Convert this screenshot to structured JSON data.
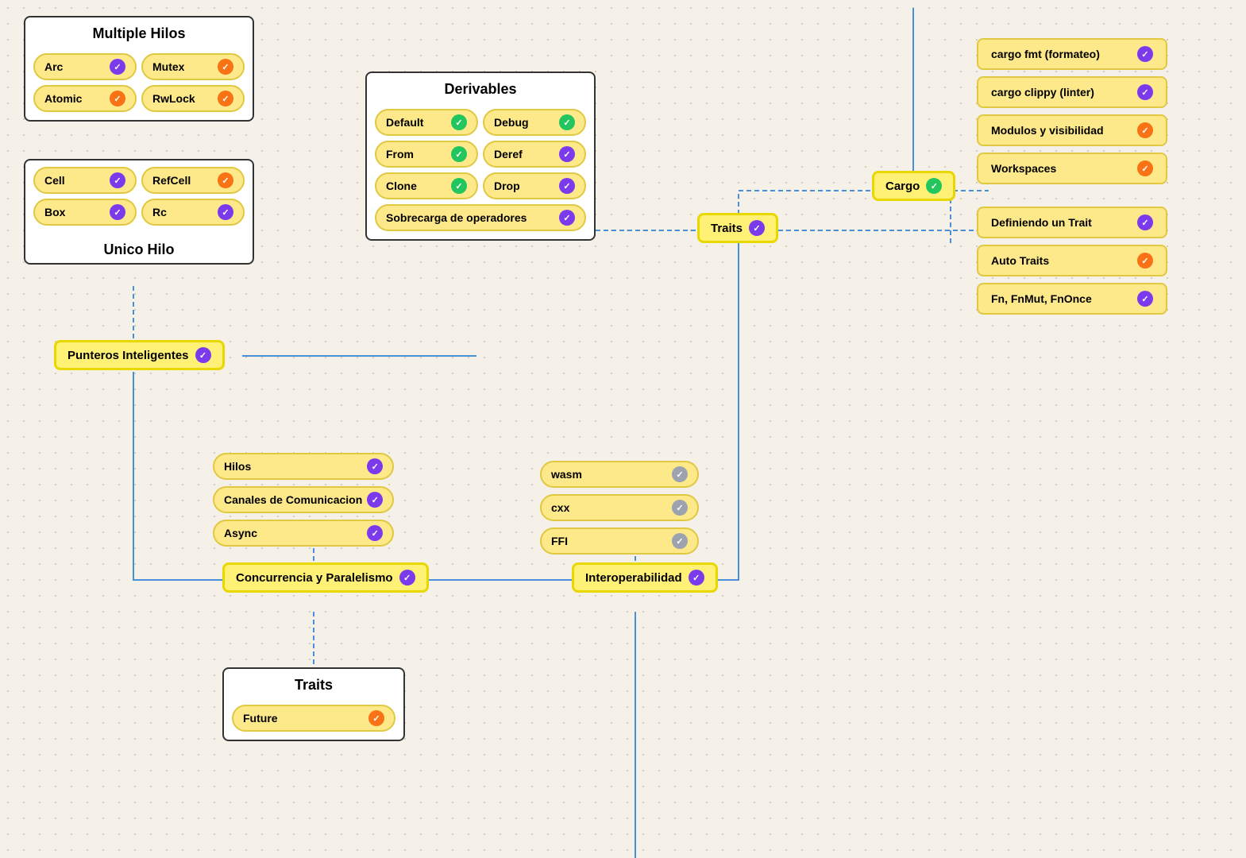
{
  "multipleHilos": {
    "title": "Multiple Hilos",
    "items": [
      {
        "label": "Arc",
        "check": "purple"
      },
      {
        "label": "Mutex",
        "check": "orange"
      },
      {
        "label": "Atomic",
        "check": "orange"
      },
      {
        "label": "RwLock",
        "check": "orange"
      }
    ]
  },
  "unicoHilo": {
    "title": "Unico Hilo",
    "items": [
      {
        "label": "Cell",
        "check": "purple"
      },
      {
        "label": "RefCell",
        "check": "orange"
      },
      {
        "label": "Box",
        "check": "purple"
      },
      {
        "label": "Rc",
        "check": "purple"
      }
    ]
  },
  "punterosInteligentes": {
    "label": "Punteros Inteligentes",
    "check": "purple"
  },
  "derivables": {
    "title": "Derivables",
    "items": [
      {
        "label": "Default",
        "check": "green"
      },
      {
        "label": "Debug",
        "check": "green"
      },
      {
        "label": "From",
        "check": "green"
      },
      {
        "label": "Deref",
        "check": "purple"
      },
      {
        "label": "Clone",
        "check": "green"
      },
      {
        "label": "Drop",
        "check": "purple"
      },
      {
        "label": "Sobrecarga de operadores",
        "check": "purple",
        "wide": true
      }
    ]
  },
  "traits": {
    "label": "Traits",
    "check": "purple"
  },
  "cargo": {
    "label": "Cargo",
    "check": "green"
  },
  "cargoItems": [
    {
      "label": "cargo fmt (formateo)",
      "check": "purple"
    },
    {
      "label": "cargo clippy (linter)",
      "check": "purple"
    },
    {
      "label": "Modulos y visibilidad",
      "check": "orange"
    },
    {
      "label": "Workspaces",
      "check": "orange"
    }
  ],
  "traitsItems": [
    {
      "label": "Definiendo un Trait",
      "check": "purple"
    },
    {
      "label": "Auto Traits",
      "check": "orange"
    },
    {
      "label": "Fn, FnMut, FnOnce",
      "check": "purple"
    }
  ],
  "concurrencia": {
    "label": "Concurrencia y Paralelismo",
    "check": "purple"
  },
  "concurrenciaItems": [
    {
      "label": "Hilos",
      "check": "purple"
    },
    {
      "label": "Canales de Comunicacion",
      "check": "purple"
    },
    {
      "label": "Async",
      "check": "purple"
    }
  ],
  "interoperabilidad": {
    "label": "Interoperabilidad",
    "check": "purple"
  },
  "interopItems": [
    {
      "label": "wasm",
      "check": "gray"
    },
    {
      "label": "cxx",
      "check": "gray"
    },
    {
      "label": "FFI",
      "check": "gray"
    }
  ],
  "traitsBottom": {
    "title": "Traits",
    "items": [
      {
        "label": "Future",
        "check": "orange"
      }
    ]
  }
}
